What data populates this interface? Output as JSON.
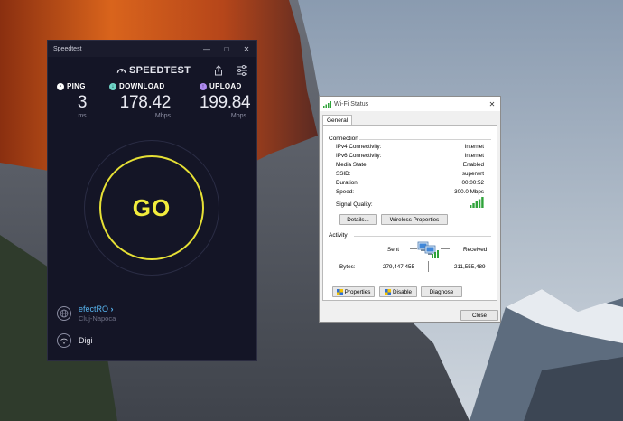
{
  "speedtest": {
    "window_title": "Speedtest",
    "logo_text": "SPEEDTEST",
    "ping": {
      "label": "PING",
      "value": "3",
      "unit": "ms"
    },
    "download": {
      "label": "DOWNLOAD",
      "value": "178.42",
      "unit": "Mbps"
    },
    "upload": {
      "label": "UPLOAD",
      "value": "199.84",
      "unit": "Mbps"
    },
    "go_label": "GO",
    "server": {
      "name": "efectRO",
      "location": "Cluj-Napoca"
    },
    "isp": "Digi",
    "colors": {
      "background": "#141526",
      "go": "#e6e035",
      "download": "#6fd6c8",
      "upload": "#b08bf2",
      "server": "#57b5f0"
    }
  },
  "wifi": {
    "window_title": "Wi-Fi Status",
    "tab": "General",
    "connection": {
      "group_label": "Connection",
      "rows": [
        {
          "label": "IPv4 Connectivity:",
          "value": "Internet"
        },
        {
          "label": "IPv6 Connectivity:",
          "value": "Internet"
        },
        {
          "label": "Media State:",
          "value": "Enabled"
        },
        {
          "label": "SSID:",
          "value": "superwrt"
        },
        {
          "label": "Duration:",
          "value": "00:00:52"
        },
        {
          "label": "Speed:",
          "value": "300.0 Mbps"
        }
      ],
      "signal_label": "Signal Quality:",
      "details_button": "Details...",
      "wireless_props_button": "Wireless Properties"
    },
    "activity": {
      "group_label": "Activity",
      "sent_label": "Sent",
      "received_label": "Received",
      "bytes_label": "Bytes:",
      "bytes_sent": "279,447,455",
      "bytes_received": "211,555,489",
      "properties_button": "Properties",
      "disable_button": "Disable",
      "diagnose_button": "Diagnose"
    },
    "close_button": "Close"
  }
}
